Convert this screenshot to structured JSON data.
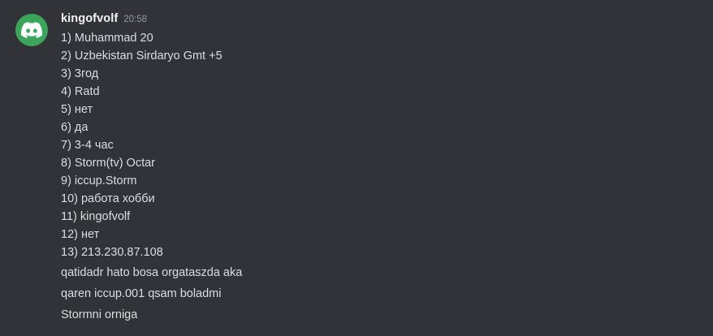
{
  "message": {
    "author": "kingofvolf",
    "timestamp": "20:58",
    "avatar_icon": "discord-logo-icon",
    "avatar_color": "#3ba55c",
    "lines": [
      "1) Muhammad 20",
      "2) Uzbekistan Sirdaryo Gmt +5",
      "3) 3год",
      "4) Ratd",
      "5) нет",
      "6) да",
      "7) 3-4 час",
      "8) Storm(tv) Octar",
      "9) iccup.Storm",
      "10) работа хобби",
      "11) kingofvolf",
      "12) нет",
      "13) 213.230.87.108"
    ]
  },
  "followups": [
    "qatidadr hato bosa orgataszda aka",
    "qaren iccup.001 qsam boladmi",
    "Stormni orniga"
  ],
  "colors": {
    "background": "#313338",
    "text": "#dbdee1",
    "username": "#f2f3f5",
    "timestamp": "#949ba4"
  }
}
